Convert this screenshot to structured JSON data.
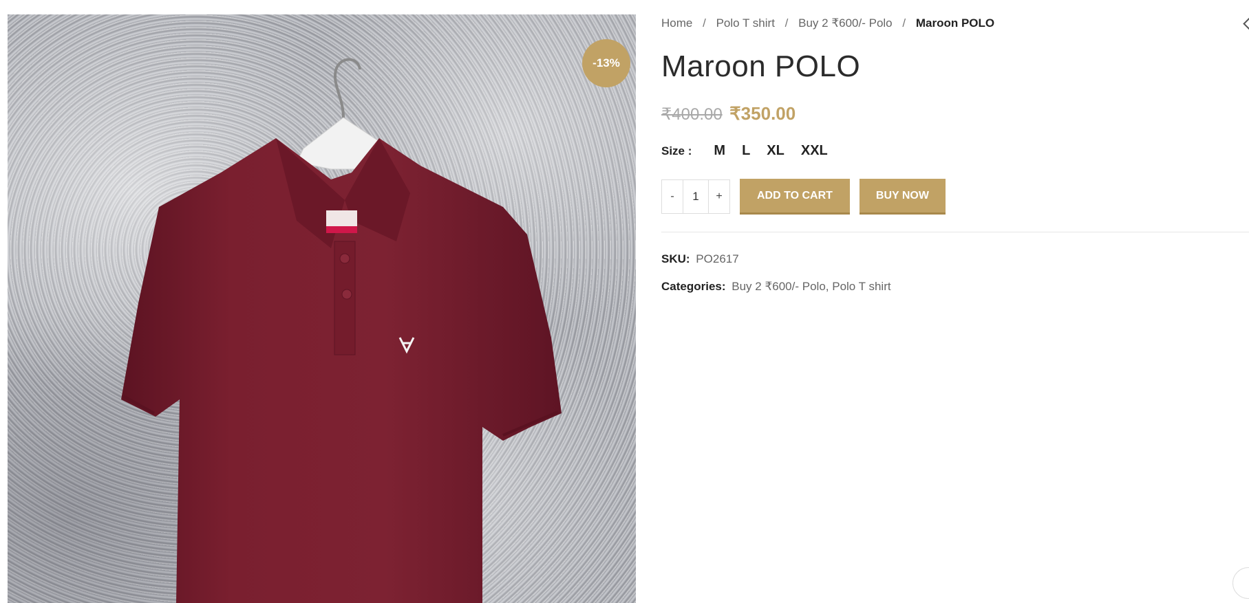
{
  "product_image": {
    "alt": "Maroon POLO",
    "badge": "-13%",
    "garment_color": "#7a1f2f",
    "badge_color": "#c1a265"
  },
  "breadcrumb": {
    "items": [
      "Home",
      "Polo T shirt",
      "Buy 2 ₹600/- Polo"
    ],
    "current": "Maroon POLO",
    "separator": "/"
  },
  "product": {
    "title": "Maroon POLO",
    "price_old": "₹400.00",
    "price_new": "₹350.00"
  },
  "size": {
    "label": "Size :",
    "options": [
      "M",
      "L",
      "XL",
      "XXL"
    ]
  },
  "cart": {
    "minus": "-",
    "quantity": "1",
    "plus": "+",
    "add_to_cart": "ADD TO CART",
    "buy_now": "BUY NOW"
  },
  "meta": {
    "sku_label": "SKU:",
    "sku_value": "PO2617",
    "categories_label": "Categories:",
    "categories": [
      "Buy 2 ₹600/- Polo",
      "Polo T shirt"
    ]
  },
  "colors": {
    "accent": "#c1a265",
    "text_dark": "#222222",
    "text_muted": "#666666"
  }
}
